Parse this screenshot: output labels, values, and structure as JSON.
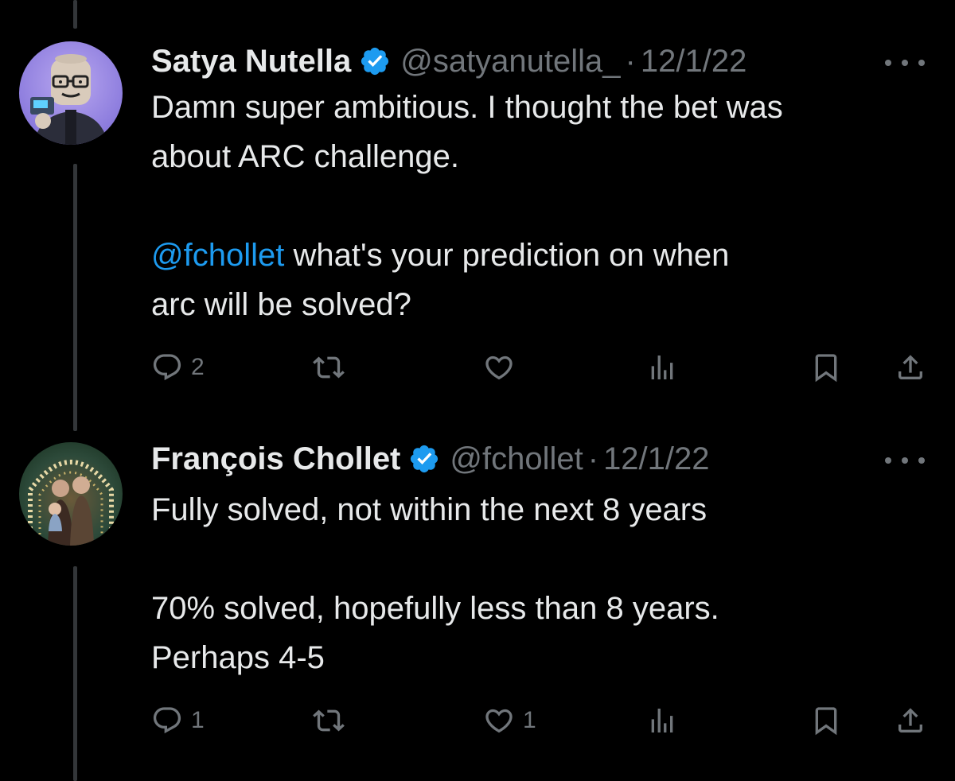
{
  "tweets": [
    {
      "name": "Satya Nutella",
      "handle": "@satyanutella_",
      "separator": "·",
      "date": "12/1/22",
      "line1": "Damn super ambitious. I thought the bet was",
      "line2": "about ARC challenge.",
      "mention": "@fchollet",
      "line3_rest": " what's your prediction on when",
      "line4": "arc will be solved?",
      "reply_count": "2",
      "retweet_count": "",
      "like_count": "",
      "views_count": ""
    },
    {
      "name": "François Chollet",
      "handle": "@fchollet",
      "separator": "·",
      "date": "12/1/22",
      "line1": "Fully solved, not within the next 8 years",
      "line3": "70% solved, hopefully less than 8 years.",
      "line4": "Perhaps 4-5",
      "reply_count": "1",
      "retweet_count": "",
      "like_count": "1",
      "views_count": ""
    }
  ],
  "icons": {
    "verified": "verified-badge-icon",
    "more": "more-icon",
    "reply": "reply-icon",
    "retweet": "retweet-icon",
    "like": "like-icon",
    "views": "views-icon",
    "bookmark": "bookmark-icon",
    "share": "share-icon"
  },
  "colors": {
    "background": "#000000",
    "text": "#e7e9ea",
    "muted": "#71767b",
    "accent": "#1d9bf0",
    "thread_line": "#333639"
  }
}
